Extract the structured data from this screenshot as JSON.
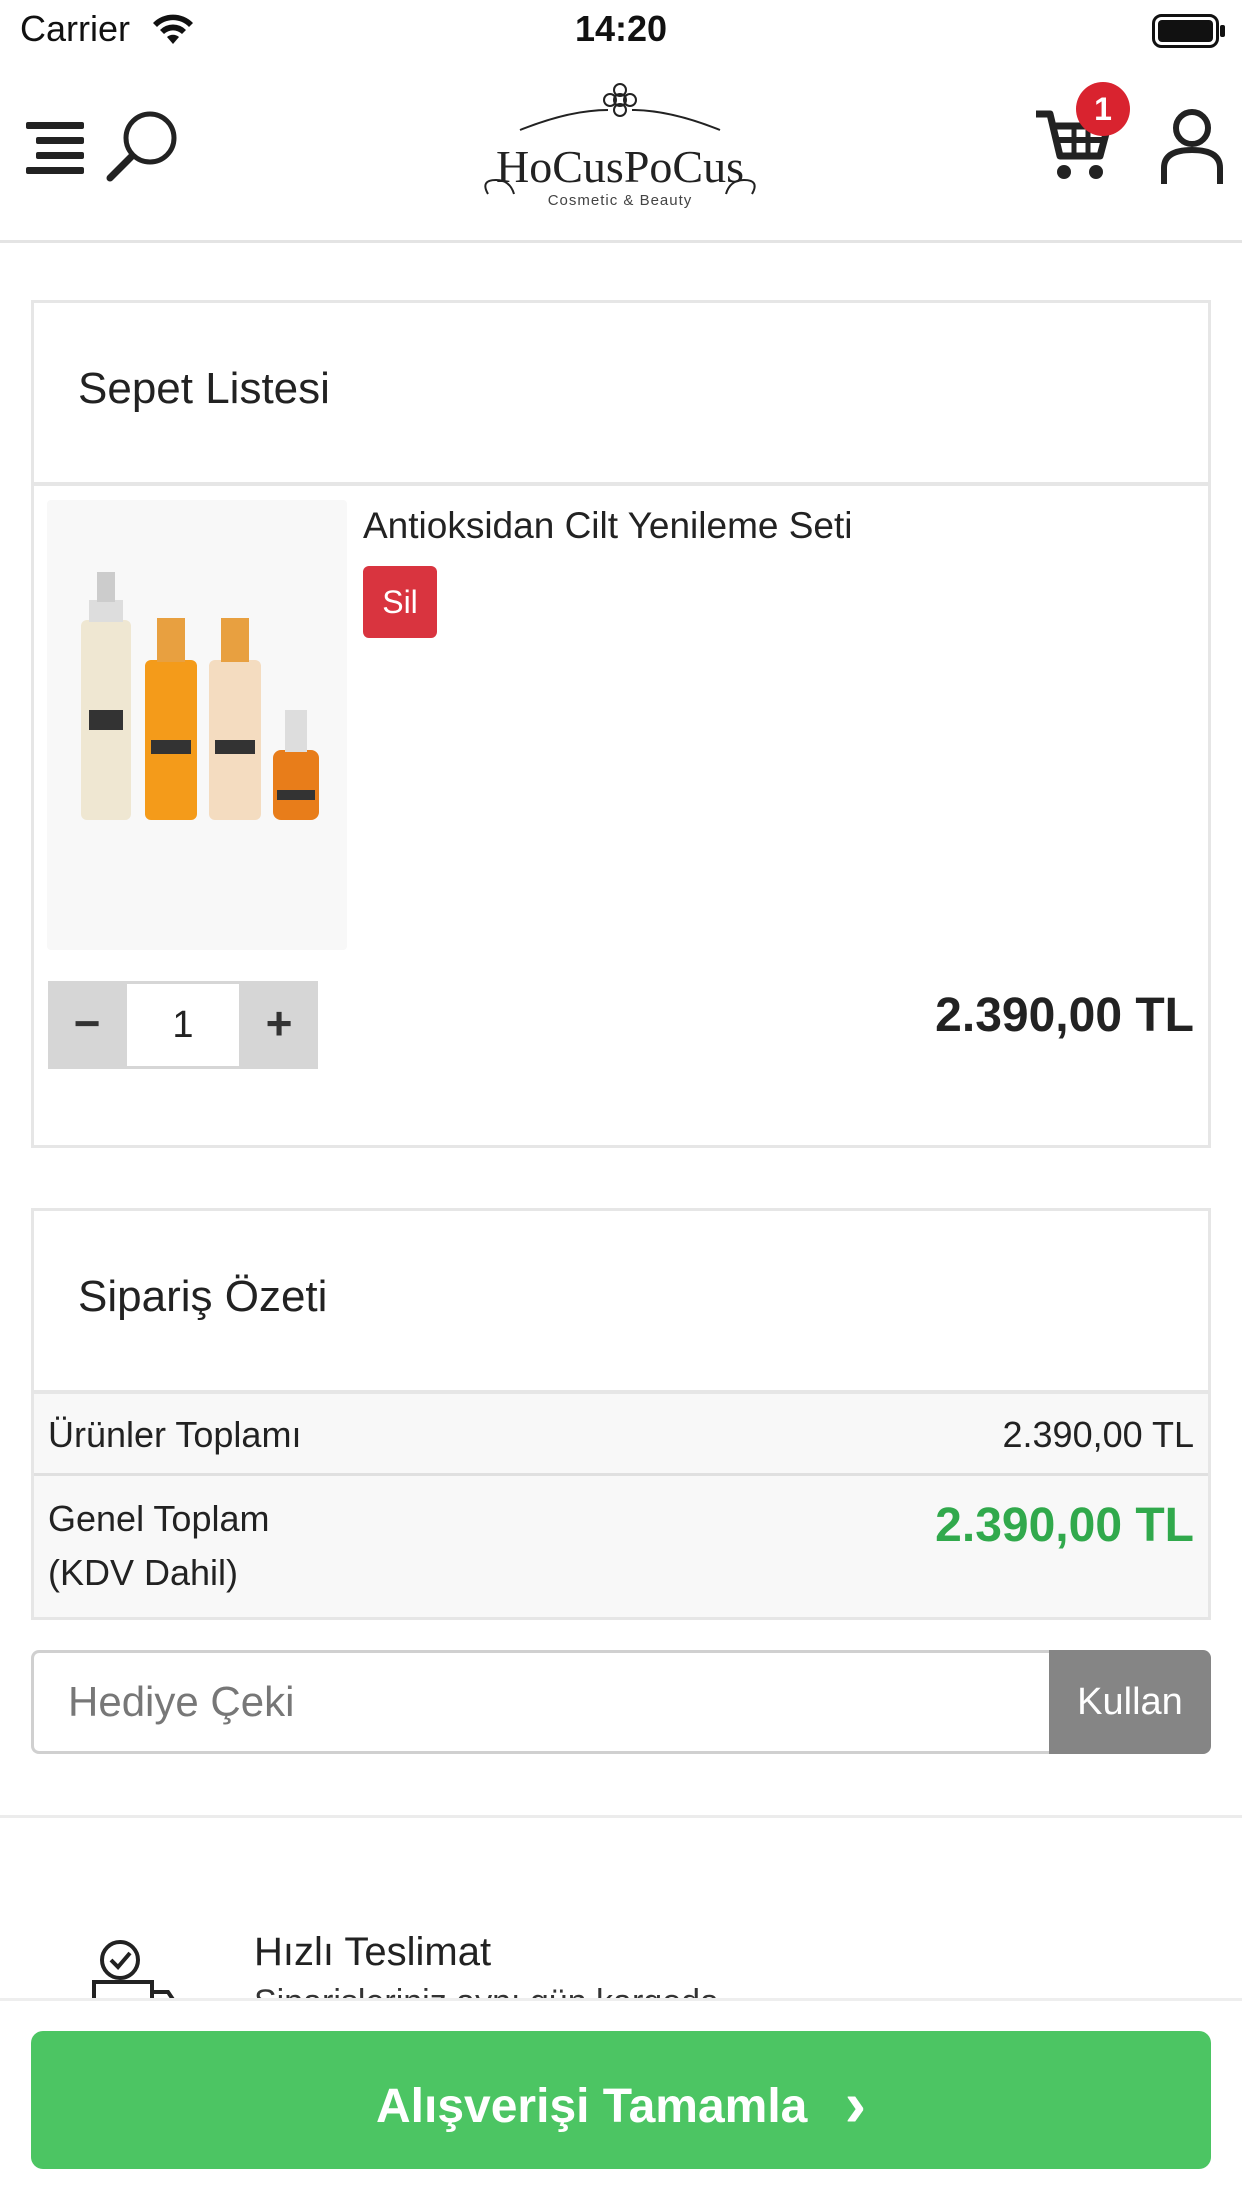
{
  "status_bar": {
    "carrier": "Carrier",
    "time": "14:20"
  },
  "header": {
    "logo_text": "HoCusPoCus",
    "logo_subtitle": "Cosmetic & Beauty",
    "cart_count": "1",
    "icons": [
      "menu-icon",
      "search-icon",
      "cart-icon",
      "user-icon"
    ]
  },
  "cart": {
    "title": "Sepet Listesi",
    "items": [
      {
        "name": "Antioksidan Cilt Yenileme Seti",
        "delete_label": "Sil",
        "quantity": "1",
        "minus_label": "−",
        "plus_label": "+",
        "price": "2.390,00 TL"
      }
    ]
  },
  "summary": {
    "title": "Sipariş Özeti",
    "subtotal_label": "Ürünler Toplamı",
    "subtotal_value": "2.390,00 TL",
    "grand_label_line1": "Genel Toplam",
    "grand_label_line2": "(KDV Dahil)",
    "grand_value": "2.390,00 TL"
  },
  "coupon": {
    "placeholder": "Hediye Çeki",
    "button_label": "Kullan"
  },
  "delivery": {
    "title": "Hızlı Teslimat",
    "subtitle": "Siparişleriniz aynı gün kargoda"
  },
  "checkout": {
    "label": "Alışverişi Tamamla",
    "arrow": "›"
  },
  "colors": {
    "accent_green": "#4cc563",
    "price_green": "#31a94c",
    "danger_red": "#d9343f",
    "badge_red": "#d9232f"
  }
}
